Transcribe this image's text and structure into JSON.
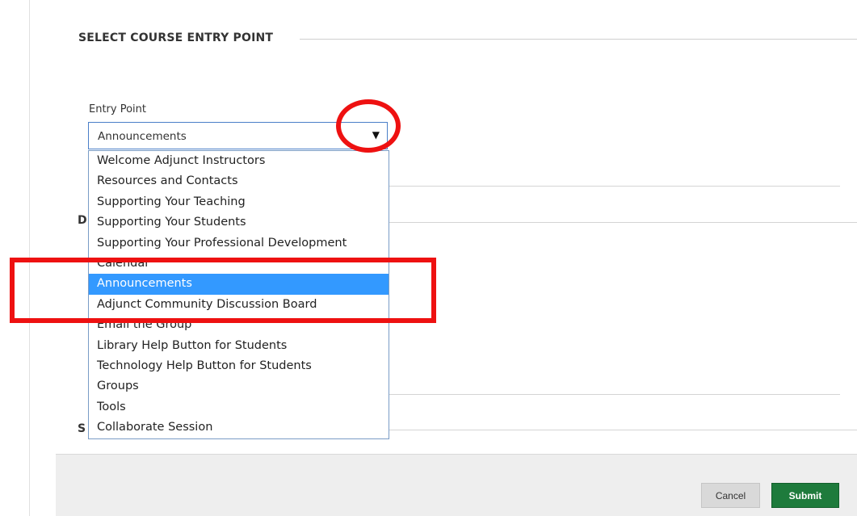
{
  "section": {
    "title": "SELECT COURSE ENTRY POINT"
  },
  "entry_point": {
    "label": "Entry Point",
    "selected_value": "Announcements",
    "arrow": "▼",
    "options": [
      "Welcome Adjunct Instructors",
      "Resources and Contacts",
      "Supporting Your Teaching",
      "Supporting Your Students",
      "Supporting Your Professional Development",
      "Calendar",
      "Announcements",
      "Adjunct Community Discussion Board",
      "Email the Group",
      "Library Help Button for Students",
      "Technology Help Button for Students",
      "Groups",
      "Tools",
      "Collaborate Session"
    ],
    "highlighted_option": "Announcements"
  },
  "partial_headings": {
    "d": "D",
    "s": "S"
  },
  "footer": {
    "cancel_label": "Cancel",
    "submit_label": "Submit"
  },
  "colors": {
    "selected_option": "#3399ff",
    "submit_button": "#1e7b3c",
    "annotation": "#ee1111"
  }
}
